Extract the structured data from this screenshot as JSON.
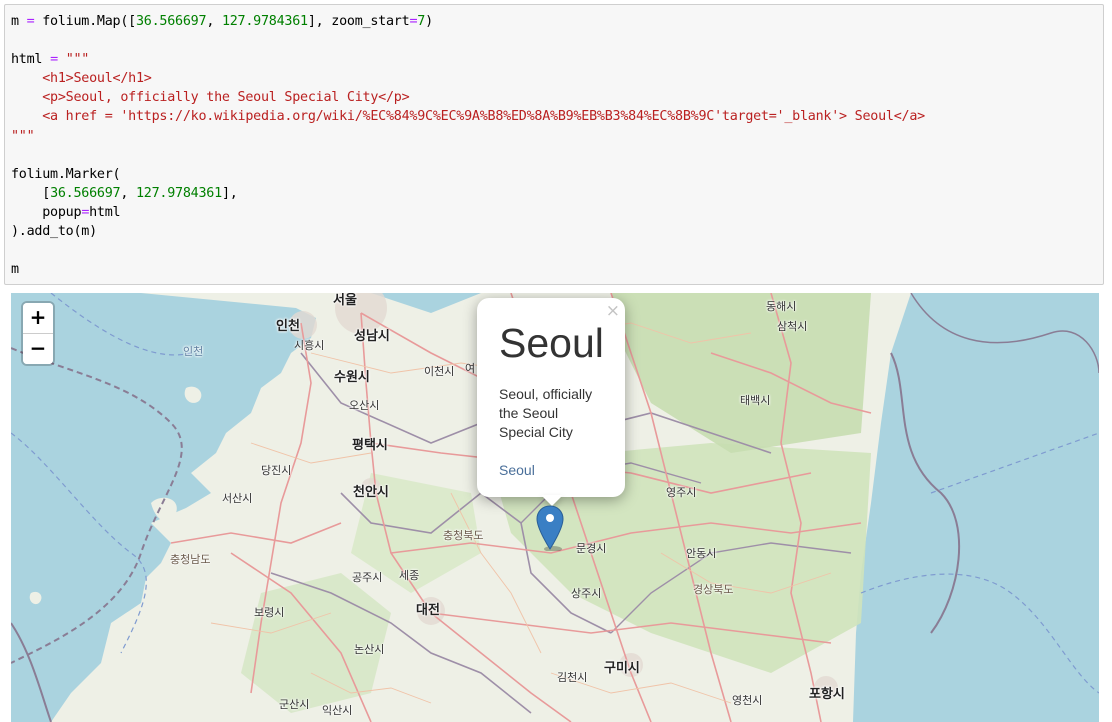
{
  "code_cell": {
    "lines": [
      [
        [
          "t",
          "m "
        ],
        [
          "op",
          "="
        ],
        [
          "t",
          " folium.Map(["
        ],
        [
          "num",
          "36.566697"
        ],
        [
          "t",
          ", "
        ],
        [
          "num",
          "127.9784361"
        ],
        [
          "t",
          "], zoom_start"
        ],
        [
          "op",
          "="
        ],
        [
          "num",
          "7"
        ],
        [
          "t",
          ")"
        ]
      ],
      [],
      [
        [
          "t",
          "html "
        ],
        [
          "op",
          "="
        ],
        [
          "t",
          " "
        ],
        [
          "str",
          "\"\"\""
        ]
      ],
      [
        [
          "str",
          "    <h1>Seoul</h1>"
        ]
      ],
      [
        [
          "str",
          "    <p>Seoul, officially the Seoul Special City</p>"
        ]
      ],
      [
        [
          "str",
          "    <a href = 'https://ko.wikipedia.org/wiki/%EC%84%9C%EC%9A%B8%ED%8A%B9%EB%B3%84%EC%8B%9C'target='_blank'> Seoul</a>"
        ]
      ],
      [
        [
          "str",
          "\"\"\""
        ]
      ],
      [],
      [
        [
          "t",
          "folium.Marker("
        ]
      ],
      [
        [
          "t",
          "    ["
        ],
        [
          "num",
          "36.566697"
        ],
        [
          "t",
          ", "
        ],
        [
          "num",
          "127.9784361"
        ],
        [
          "t",
          "],"
        ]
      ],
      [
        [
          "t",
          "    popup"
        ],
        [
          "op",
          "="
        ],
        [
          "t",
          "html"
        ]
      ],
      [
        [
          "t",
          ").add_to(m)"
        ]
      ],
      [],
      [
        [
          "t",
          "m"
        ]
      ]
    ]
  },
  "map": {
    "zoom_in": "+",
    "zoom_out": "−",
    "popup": {
      "close": "×",
      "title": "Seoul",
      "text": "Seoul, officially the Seoul Special City",
      "link": "Seoul"
    },
    "marker_icon": "map-pin-icon",
    "labels": {
      "seoul": "서울",
      "incheon": "인천",
      "seongnam": "성남시",
      "siheung": "시흥시",
      "suwon": "수원시",
      "icheon": "이천시",
      "yeo": "여",
      "osan": "오산시",
      "pyeongtaek": "평택시",
      "dangjin": "당진시",
      "cheonan": "천안시",
      "seosan": "서산시",
      "chungbuk": "충청북도",
      "chungnam": "충청남도",
      "gongju": "공주시",
      "sejong": "세종",
      "daejeon": "대전",
      "boryeong": "보령시",
      "nonsan": "논산시",
      "gunsan": "군산시",
      "iksan": "익산시",
      "sangju": "상주시",
      "mungyeong": "문경시",
      "yeongju": "영주시",
      "andong": "안동시",
      "gyeongbuk": "경상북도",
      "gumi": "구미시",
      "gimcheon": "김천시",
      "yeongcheon": "영천시",
      "pohang": "포항시",
      "taebaek": "태백시",
      "donghae": "동해시",
      "samcheok": "삼척시",
      "incheon_sea": "인천"
    }
  },
  "colors": {
    "sea": "#aad3df",
    "land": "#eef0e6",
    "forest": "#c8dfb4",
    "road": "#e89a9a",
    "boundary": "#8a7d95"
  }
}
